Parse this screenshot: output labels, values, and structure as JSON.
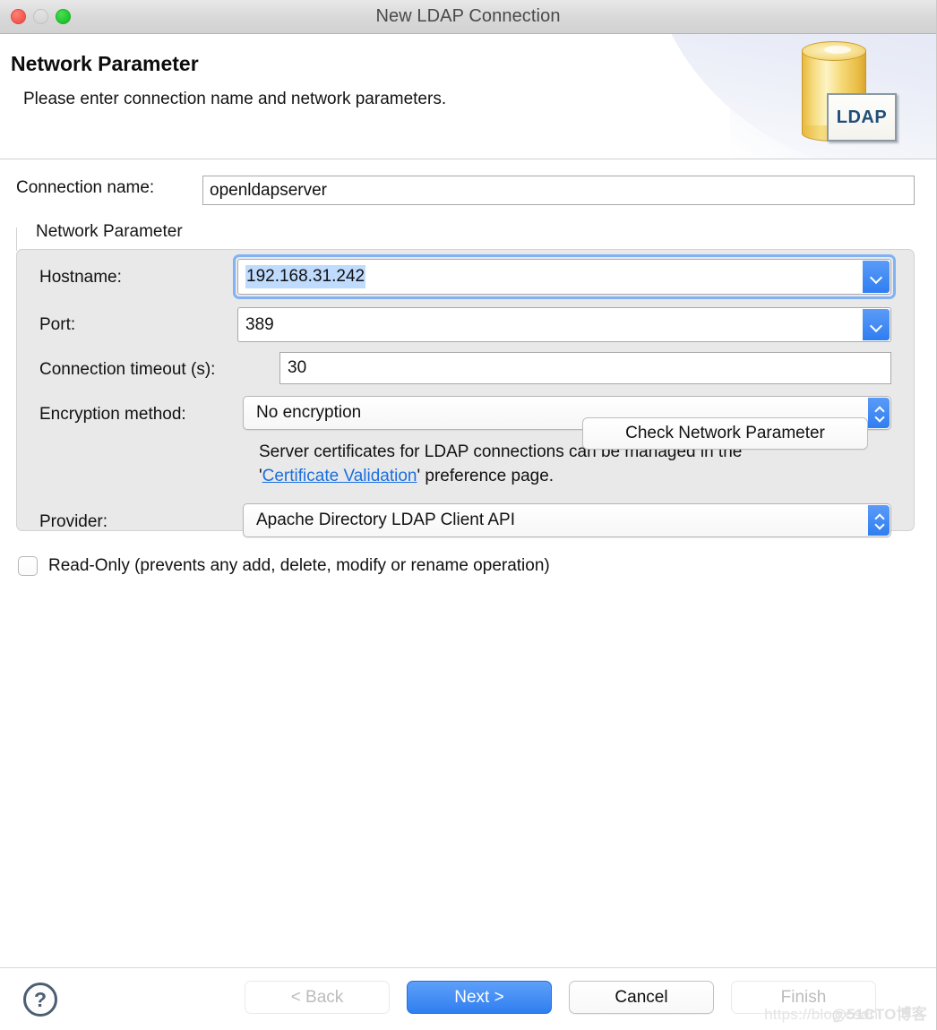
{
  "window": {
    "title": "New LDAP Connection",
    "traffic_lights": [
      "close-button",
      "minimize-button",
      "zoom-button"
    ]
  },
  "header": {
    "title": "Network Parameter",
    "subtitle": "Please enter connection name and network parameters.",
    "icon_label": "LDAP",
    "icon_name": "ldap-database-icon"
  },
  "form": {
    "connection_name": {
      "label": "Connection name:",
      "value": "openldapserver",
      "placeholder": ""
    },
    "group_title": "Network Parameter",
    "hostname": {
      "label": "Hostname:",
      "value": "192.168.31.242",
      "focused": true,
      "text_selected": true
    },
    "port": {
      "label": "Port:",
      "value": "389"
    },
    "timeout": {
      "label": "Connection timeout (s):",
      "value": "30"
    },
    "encryption": {
      "label": "Encryption method:",
      "value": "No encryption"
    },
    "cert_note": {
      "line1": "Server certificates for LDAP connections can be managed in the",
      "prefix": "'",
      "link": "Certificate Validation",
      "suffix": "' preference page."
    },
    "provider": {
      "label": "Provider:",
      "value": "Apache Directory LDAP Client API"
    },
    "check_button": "Check Network Parameter",
    "read_only": {
      "label": "Read-Only (prevents any add, delete, modify or rename operation)",
      "checked": false
    }
  },
  "footer": {
    "help": "?",
    "back": "< Back",
    "next": "Next >",
    "cancel": "Cancel",
    "finish": "Finish"
  },
  "watermark": {
    "text1": "https://blog.csdn",
    "text2": "@51CTO博客"
  },
  "colors": {
    "accent_blue": "#2f7ef0",
    "focus_ring": "#82b2f6",
    "selection": "#bfdbfd",
    "link": "#1a6fe0",
    "panel_gray": "#e9e9e9"
  }
}
